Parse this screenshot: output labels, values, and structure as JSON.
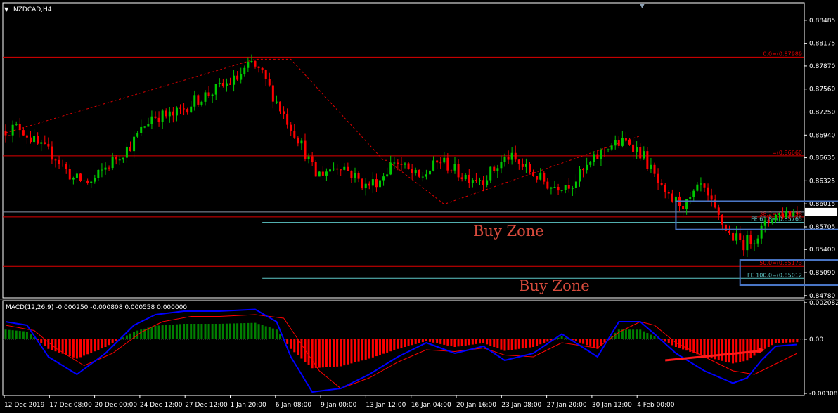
{
  "window_title": "NZDCAD,H4",
  "colors": {
    "background": "#000000",
    "frame": "#ffffff",
    "bull_candle": "#00c800",
    "bear_candle": "#ff0000",
    "fibo_red": "#e00000",
    "fibo_cyan": "#5ec8c8",
    "macd_line": "#0000ff",
    "signal_line": "#ff0000",
    "hist_up": "#008000",
    "hist_down": "#ff0000",
    "zone_border": "#4a76c6",
    "arrow": "#ff1a1a",
    "current_price_bg": "#ffffff"
  },
  "chart_data": [
    {
      "type": "candlestick",
      "symbol": "NZDCAD",
      "timeframe": "H4",
      "ylim": [
        0.8475,
        0.8872
      ],
      "y_ticks": [
        "0.88485",
        "0.88175",
        "0.87870",
        "0.87560",
        "0.87250",
        "0.86940",
        "0.86635",
        "0.86325",
        "0.86015",
        "0.85705",
        "0.85400",
        "0.85090",
        "0.84780"
      ],
      "x_ticks": [
        "12 Dec 2019",
        "17 Dec 08:00",
        "20 Dec 00:00",
        "24 Dec 12:00",
        "27 Dec 12:00",
        "1 Jan 20:00",
        "6 Jan 08:00",
        "9 Jan 00:00",
        "13 Jan 12:00",
        "16 Jan 04:00",
        "20 Jan 16:00",
        "23 Jan 08:00",
        "27 Jan 20:00",
        "30 Jan 12:00",
        "4 Feb 00:00"
      ],
      "current_price": "0.85904",
      "swing_path": [
        [
          0,
          0.8697
        ],
        [
          70,
          0.8796
        ],
        [
          80,
          0.8796
        ],
        [
          106,
          0.866
        ],
        [
          107,
          0.866
        ],
        [
          123,
          0.8601
        ],
        [
          178,
          0.8693
        ]
      ],
      "levels": [
        {
          "label": "0.0=(0.87989",
          "price": 0.87989,
          "color": "red",
          "x_from": 0
        },
        {
          "label": "=(0.86660",
          "price": 0.8666,
          "color": "red",
          "x_from": 0
        },
        {
          "label": "38.2=(0.85838",
          "price": 0.85838,
          "color": "red",
          "x_from": 0
        },
        {
          "label": "FE 61.8=(0.85765",
          "price": 0.85765,
          "color": "cyan",
          "x_from": 72
        },
        {
          "label": "50.0=(0.85173",
          "price": 0.85173,
          "color": "red",
          "x_from": 0
        },
        {
          "label": "FE 100.0=(0.85012",
          "price": 0.85012,
          "color": "cyan",
          "x_from": 72
        }
      ],
      "zones": [
        {
          "label": "Buy Zone",
          "x_from": 188,
          "x_to": 236,
          "price_from": 0.8605,
          "price_to": 0.8567
        },
        {
          "label": "Buy Zone",
          "x_from": 206,
          "x_to": 256,
          "price_from": 0.8526,
          "price_to": 0.8492
        }
      ],
      "waypoints": [
        [
          0,
          0.87
        ],
        [
          5,
          0.8705
        ],
        [
          10,
          0.868
        ],
        [
          15,
          0.8665
        ],
        [
          20,
          0.8635
        ],
        [
          25,
          0.863
        ],
        [
          30,
          0.8655
        ],
        [
          36,
          0.868
        ],
        [
          42,
          0.872
        ],
        [
          48,
          0.872
        ],
        [
          54,
          0.874
        ],
        [
          60,
          0.8755
        ],
        [
          66,
          0.877
        ],
        [
          70,
          0.879
        ],
        [
          73,
          0.8775
        ],
        [
          78,
          0.873
        ],
        [
          83,
          0.869
        ],
        [
          88,
          0.864
        ],
        [
          95,
          0.8655
        ],
        [
          102,
          0.8625
        ],
        [
          106,
          0.8635
        ],
        [
          110,
          0.866
        ],
        [
          117,
          0.8635
        ],
        [
          123,
          0.866
        ],
        [
          129,
          0.864
        ],
        [
          135,
          0.8635
        ],
        [
          142,
          0.8665
        ],
        [
          148,
          0.8645
        ],
        [
          154,
          0.8625
        ],
        [
          160,
          0.863
        ],
        [
          166,
          0.866
        ],
        [
          170,
          0.868
        ],
        [
          176,
          0.8685
        ],
        [
          180,
          0.8665
        ],
        [
          186,
          0.861
        ],
        [
          192,
          0.86
        ],
        [
          196,
          0.8625
        ],
        [
          200,
          0.859
        ],
        [
          204,
          0.856
        ],
        [
          208,
          0.8548
        ],
        [
          212,
          0.856
        ],
        [
          216,
          0.8585
        ],
        [
          220,
          0.859
        ],
        [
          222,
          0.859
        ]
      ]
    },
    {
      "type": "macd",
      "title": "MACD(12,26,9) -0.000250 -0.000808 0.000558 0.000000",
      "ylim": [
        -0.0032,
        0.0022
      ],
      "y_ticks": [
        "0.002082",
        "0.00",
        "-0.00308"
      ],
      "macd_waypoints": [
        [
          0,
          0.001
        ],
        [
          6,
          0.0008
        ],
        [
          12,
          -0.001
        ],
        [
          20,
          -0.002
        ],
        [
          28,
          -0.0008
        ],
        [
          36,
          0.0008
        ],
        [
          42,
          0.0014
        ],
        [
          50,
          0.0016
        ],
        [
          60,
          0.0016
        ],
        [
          70,
          0.0017
        ],
        [
          76,
          0.001
        ],
        [
          80,
          -0.001
        ],
        [
          86,
          -0.003
        ],
        [
          94,
          -0.0028
        ],
        [
          102,
          -0.002
        ],
        [
          110,
          -0.001
        ],
        [
          118,
          -0.0002
        ],
        [
          126,
          -0.0008
        ],
        [
          134,
          -0.0004
        ],
        [
          140,
          -0.0012
        ],
        [
          148,
          -0.0008
        ],
        [
          156,
          0.0003
        ],
        [
          166,
          -0.001
        ],
        [
          172,
          0.001
        ],
        [
          178,
          0.001
        ],
        [
          182,
          0.0003
        ],
        [
          188,
          -0.0008
        ],
        [
          196,
          -0.0018
        ],
        [
          204,
          -0.0025
        ],
        [
          208,
          -0.0022
        ],
        [
          212,
          -0.0012
        ],
        [
          216,
          -0.0004
        ],
        [
          222,
          -0.0003
        ]
      ],
      "signal_waypoints": [
        [
          0,
          0.0008
        ],
        [
          8,
          0.0005
        ],
        [
          14,
          -0.0005
        ],
        [
          22,
          -0.0015
        ],
        [
          30,
          -0.0008
        ],
        [
          38,
          0.0004
        ],
        [
          44,
          0.001
        ],
        [
          52,
          0.0013
        ],
        [
          60,
          0.0013
        ],
        [
          70,
          0.0014
        ],
        [
          78,
          0.0012
        ],
        [
          82,
          0.0
        ],
        [
          88,
          -0.0018
        ],
        [
          94,
          -0.0028
        ],
        [
          102,
          -0.0022
        ],
        [
          110,
          -0.0013
        ],
        [
          118,
          -0.0006
        ],
        [
          126,
          -0.0007
        ],
        [
          134,
          -0.0005
        ],
        [
          140,
          -0.0009
        ],
        [
          148,
          -0.001
        ],
        [
          156,
          -0.0002
        ],
        [
          166,
          -0.0005
        ],
        [
          172,
          0.0004
        ],
        [
          178,
          0.001
        ],
        [
          182,
          0.0008
        ],
        [
          188,
          -0.0002
        ],
        [
          196,
          -0.001
        ],
        [
          204,
          -0.0018
        ],
        [
          210,
          -0.002
        ],
        [
          214,
          -0.0016
        ],
        [
          218,
          -0.0012
        ],
        [
          222,
          -0.0008
        ]
      ],
      "arrow": {
        "from": [
          185,
          -0.0012
        ],
        "to": [
          213,
          -0.0006
        ]
      }
    }
  ]
}
